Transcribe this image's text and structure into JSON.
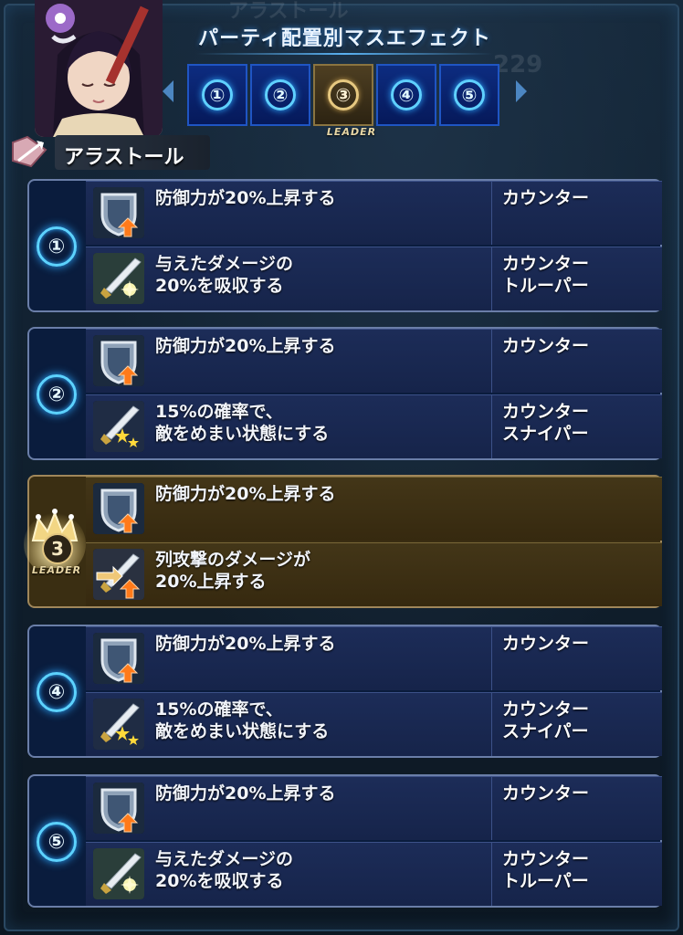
{
  "header": {
    "title": "パーティ配置別マスエフェクト",
    "character_name": "アラストール",
    "slots": [
      "①",
      "②",
      "③",
      "④",
      "⑤"
    ],
    "selected_slot": 3,
    "leader_label": "LEADER"
  },
  "groups": [
    {
      "number": "①",
      "leader": false,
      "rows": [
        {
          "icon": "defense-up-icon",
          "desc": [
            "防御力が20%上昇する"
          ],
          "type": [
            "カウンター"
          ]
        },
        {
          "icon": "lifesteal-icon",
          "desc": [
            "与えたダメージの",
            "20%を吸収する"
          ],
          "type": [
            "カウンター",
            "トルーパー"
          ]
        }
      ]
    },
    {
      "number": "②",
      "leader": false,
      "rows": [
        {
          "icon": "defense-up-icon",
          "desc": [
            "防御力が20%上昇する"
          ],
          "type": [
            "カウンター"
          ]
        },
        {
          "icon": "dizzy-icon",
          "desc": [
            "15%の確率で、",
            "敵をめまい状態にする"
          ],
          "type": [
            "カウンター",
            "スナイパー"
          ]
        }
      ]
    },
    {
      "number": "3",
      "leader": true,
      "leader_label": "LEADER",
      "rows": [
        {
          "icon": "defense-up-icon",
          "desc": [
            "防御力が20%上昇する"
          ],
          "type": []
        },
        {
          "icon": "column-attack-up-icon",
          "desc": [
            "列攻撃のダメージが",
            "20%上昇する"
          ],
          "type": []
        }
      ]
    },
    {
      "number": "④",
      "leader": false,
      "rows": [
        {
          "icon": "defense-up-icon",
          "desc": [
            "防御力が20%上昇する"
          ],
          "type": [
            "カウンター"
          ]
        },
        {
          "icon": "dizzy-icon",
          "desc": [
            "15%の確率で、",
            "敵をめまい状態にする"
          ],
          "type": [
            "カウンター",
            "スナイパー"
          ]
        }
      ]
    },
    {
      "number": "⑤",
      "leader": false,
      "rows": [
        {
          "icon": "defense-up-icon",
          "desc": [
            "防御力が20%上昇する"
          ],
          "type": [
            "カウンター"
          ]
        },
        {
          "icon": "lifesteal-icon",
          "desc": [
            "与えたダメージの",
            "20%を吸収する"
          ],
          "type": [
            "カウンター",
            "トルーパー"
          ]
        }
      ]
    }
  ],
  "colors": {
    "panel": "#0a1c3d",
    "row": "#1c2c58",
    "leader_panel": "#3a2e12",
    "badge_glow": "#5cd2ff",
    "gold": "#e2c580"
  }
}
